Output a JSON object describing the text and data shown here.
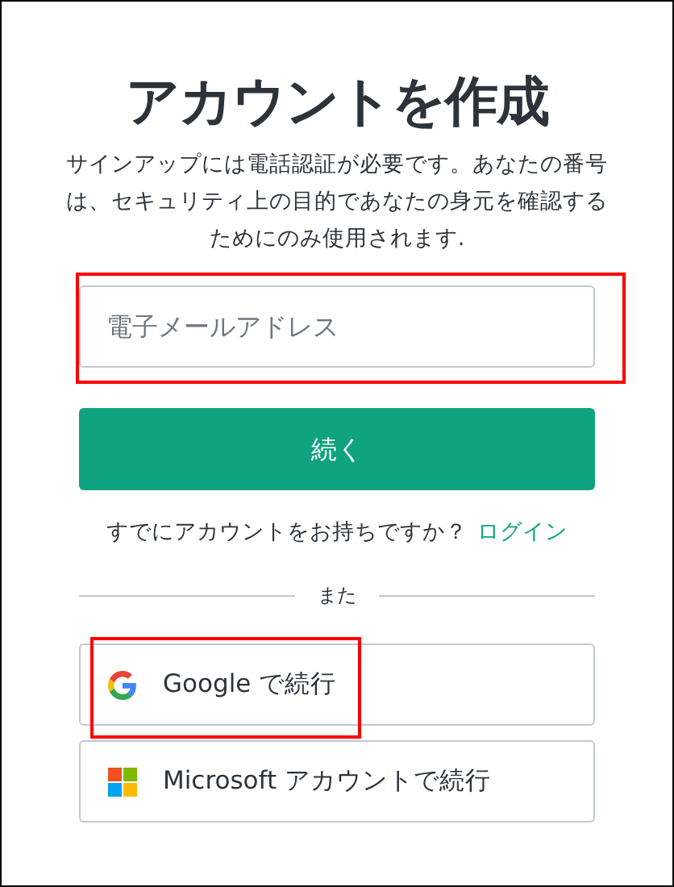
{
  "title": "アカウントを作成",
  "description": "サインアップには電話認証が必要です。あなたの番号は、セキュリティ上の目的であなたの身元を確認するためにのみ使用されます.",
  "email_field": {
    "placeholder": "電子メールアドレス"
  },
  "continue_button": "続く",
  "login_prompt": {
    "text": "すでにアカウントをお持ちですか？",
    "link": "ログイン"
  },
  "divider": "また",
  "providers": [
    {
      "kind": "google",
      "label": "Google で続行"
    },
    {
      "kind": "microsoft",
      "label": "Microsoft アカウントで続行"
    }
  ]
}
